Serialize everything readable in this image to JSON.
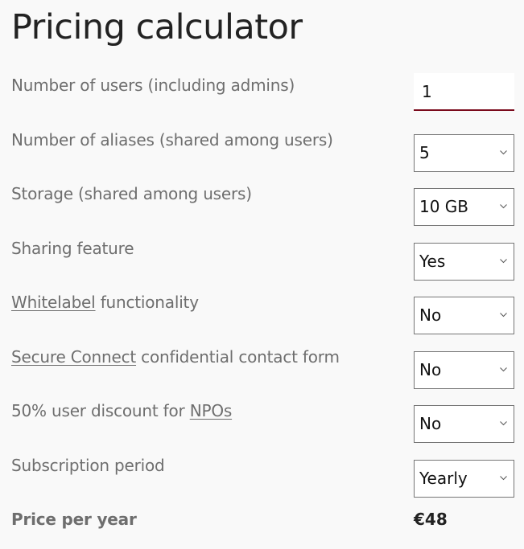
{
  "title": "Pricing calculator",
  "fields": {
    "users": {
      "label": "Number of users (including admins)",
      "value": "1"
    },
    "aliases": {
      "label": "Number of aliases (shared among users)",
      "value": "5"
    },
    "storage": {
      "label": "Storage (shared among users)",
      "value": "10 GB"
    },
    "sharing": {
      "label": "Sharing feature",
      "value": "Yes"
    },
    "whitelabel": {
      "link": "Whitelabel",
      "label_rest": " functionality",
      "value": "No"
    },
    "secure_connect": {
      "link": "Secure Connect",
      "label_rest": " confidential contact form",
      "value": "No"
    },
    "npo_discount": {
      "label_pre": "50% user discount for ",
      "link": "NPOs",
      "value": "No"
    },
    "period": {
      "label": "Subscription period",
      "value": "Yearly"
    }
  },
  "price": {
    "label": "Price per year",
    "value": "€48"
  },
  "colors": {
    "accent_underline": "#7a0a1c",
    "label_text": "#6e6e6e",
    "background": "#f9f9f9"
  }
}
